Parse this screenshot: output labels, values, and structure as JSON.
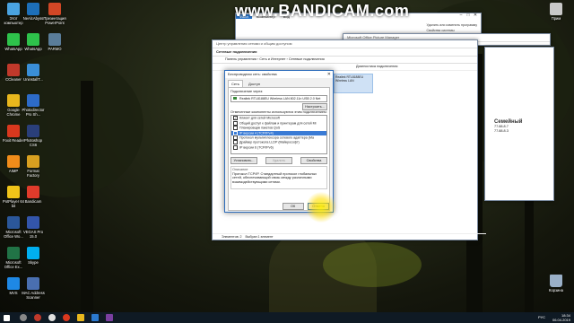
{
  "recorder": {
    "watermark": "www.BANDICAM.com"
  },
  "desktop_icons": [
    {
      "label": "Этот компьютер",
      "color": "#4aa3e0"
    },
    {
      "label": "WhatsApp",
      "color": "#2ec24b"
    },
    {
      "label": "CCleaner",
      "color": "#c0392b"
    },
    {
      "label": "Google Chrome",
      "color": "#e8b71d"
    },
    {
      "label": "Foxit Reader",
      "color": "#d9381e"
    },
    {
      "label": "AIMP",
      "color": "#f08c1a"
    },
    {
      "label": "PotPlayer 64 bit",
      "color": "#f0c419"
    },
    {
      "label": "Microsoft Office Wo...",
      "color": "#2b579a"
    },
    {
      "label": "Microsoft Office Ex...",
      "color": "#217346"
    },
    {
      "label": "MVS",
      "color": "#1e88e5"
    }
  ],
  "desktop_icons_col2": [
    {
      "label": "NeAlcAbyss",
      "color": "#1d6fb8"
    },
    {
      "label": "WhatsApp",
      "color": "#2ec24b"
    },
    {
      "label": "UninstallT...",
      "color": "#3a8fd8"
    },
    {
      "label": "Photodirector Pro Sh...",
      "color": "#2d6bc8"
    },
    {
      "label": "Photoshop CS6",
      "color": "#2a3f7a"
    },
    {
      "label": "Format Factory",
      "color": "#d8a020"
    },
    {
      "label": "Bandicam",
      "color": "#e03b2b"
    },
    {
      "label": "VEGAS Pro 15.0",
      "color": "#3355aa"
    },
    {
      "label": "Skype",
      "color": "#00aff0"
    },
    {
      "label": "MAC Address Scanner",
      "color": "#4a6fb0"
    }
  ],
  "desktop_icons_col3": [
    {
      "label": "Презентация PowerPoint",
      "color": "#d24726"
    },
    {
      "label": "PARMO",
      "color": "#5a7d9a"
    }
  ],
  "right_icons": [
    {
      "label": "Прим",
      "color": "#c8c8c8"
    },
    {
      "label": "Корзина",
      "color": "#9ab0c8"
    }
  ],
  "explorer": {
    "tabs": [
      "Файл",
      "Компьютер",
      "Вид"
    ],
    "actions": [
      "Удалить или изменить программу",
      "Свойства системы"
    ]
  },
  "picture_manager": {
    "title": "Microsoft Office Picture Manager"
  },
  "network_window": {
    "title": "Центр управления сетями и общим доступом",
    "subtitle": "Сетевые подключения",
    "address": "Панель управления  ›  Сеть и Интернет  ›  Сетевые подключения",
    "toolbar": [
      "Диагностика подключения"
    ],
    "adapter_name": "Realtek RTL8188EU Wireless LAN",
    "status": [
      "Элементов: 2",
      "Выбран 1 элемент"
    ]
  },
  "right_panel": {
    "heading": "Семейный",
    "values": [
      "77.88.8.7",
      "77.88.8.3"
    ]
  },
  "dialog": {
    "title": "Беспроводная сеть: свойства",
    "tabs": [
      "Сеть",
      "Доступ"
    ],
    "connect_using": "Подключение через:",
    "adapter": "Realtek RTL8188EU Wireless LAN 802.11n USB 2.0 Net",
    "configure": "Настроить...",
    "components_label": "Отмеченные компоненты используются этим подключением:",
    "components": [
      {
        "label": "Клиент для сетей Microsoft",
        "checked": true
      },
      {
        "label": "Общий доступ к файлам и принтерам для сетей Mi",
        "checked": true
      },
      {
        "label": "Планировщик пакетов QoS",
        "checked": true
      },
      {
        "label": "IP версии 4 (TCP/IPv4)",
        "checked": true,
        "selected": true
      },
      {
        "label": "Протокол мультиплексора сетевого адаптера (Ma",
        "checked": false
      },
      {
        "label": "Драйвер протокола LLDP (Майкрософт)",
        "checked": true
      },
      {
        "label": "IP версии 6 (TCP/IPv6)",
        "checked": true
      }
    ],
    "install": "Установить...",
    "remove": "Удалить",
    "properties": "Свойства",
    "description_label": "Описание",
    "description": "Протокол TCP/IP. Стандартный протокол глобальных сетей, обеспечивающий связь между различными взаимодействующими сетями.",
    "ok": "ОК",
    "cancel": "Отмена"
  },
  "taskbar": {
    "time": "18:34",
    "date": "06.04.2019",
    "lang": "РУС"
  }
}
